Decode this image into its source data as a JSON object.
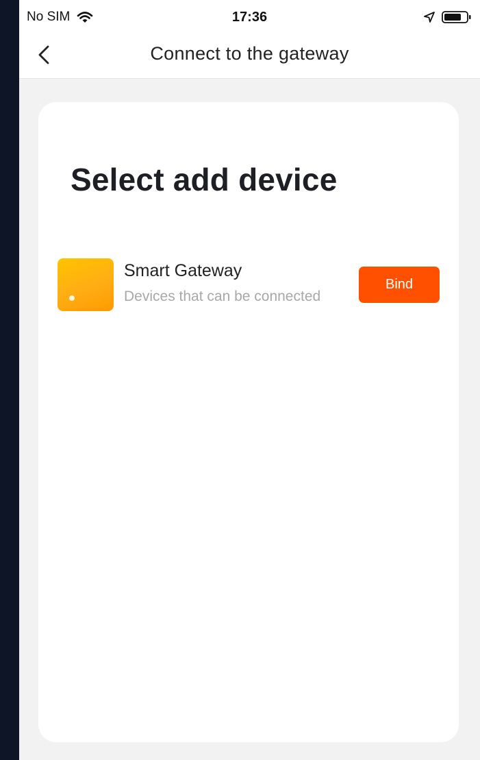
{
  "status_bar": {
    "carrier": "No SIM",
    "time": "17:36",
    "icons": [
      "wifi-icon",
      "location-arrow-icon",
      "battery-icon"
    ]
  },
  "nav": {
    "title": "Connect to the gateway",
    "back_icon": "chevron-left-icon"
  },
  "card": {
    "heading": "Select add device",
    "devices": [
      {
        "name": "Smart Gateway",
        "subtitle": "Devices that can be connected",
        "action_label": "Bind",
        "thumbnail_colors": [
          "#ffc400",
          "#ff9a00"
        ]
      }
    ]
  },
  "colors": {
    "accent": "#ff5000",
    "background": "#f2f2f2",
    "card": "#ffffff"
  }
}
